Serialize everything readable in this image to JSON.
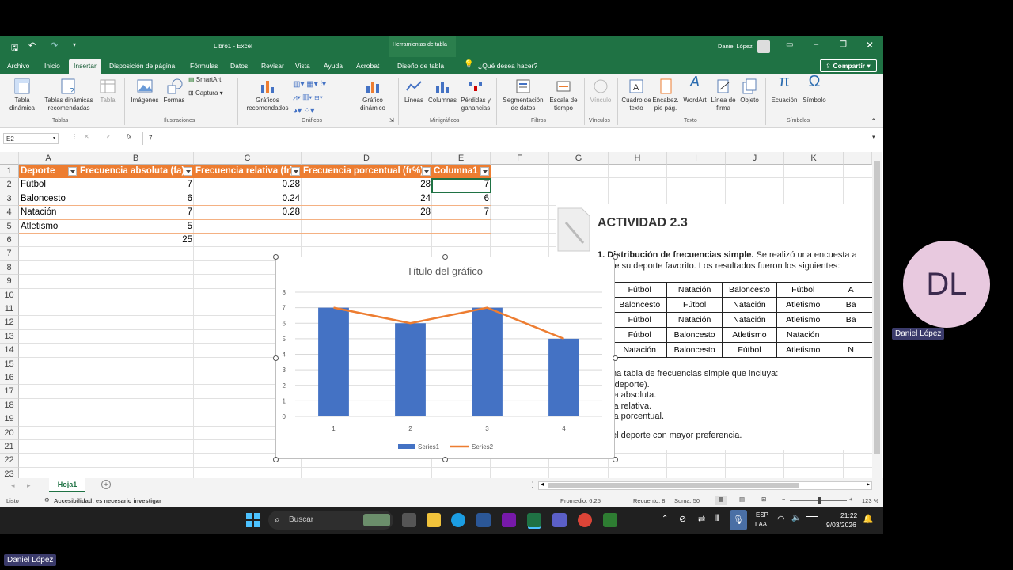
{
  "window": {
    "title": "Libro1 - Excel",
    "context_tab": "Herramientas de tabla",
    "user": "Daniel López"
  },
  "menu": [
    "Archivo",
    "Inicio",
    "Insertar",
    "Disposición de página",
    "Fórmulas",
    "Datos",
    "Revisar",
    "Vista",
    "Ayuda",
    "Acrobat",
    "Diseño de tabla"
  ],
  "menu_active": "Insertar",
  "tell_me": "¿Qué desea hacer?",
  "share": "Compartir",
  "ribbon": {
    "tabla_dinamica": "Tabla dinámica",
    "tablas_recomendadas": "Tablas dinámicas recomendadas",
    "tabla": "Tabla",
    "grupo_tablas": "Tablas",
    "imagenes": "Imágenes",
    "formas": "Formas",
    "smartart": "SmartArt",
    "captura": "Captura",
    "grupo_ilustraciones": "Ilustraciones",
    "graficos_recomendados": "Gráficos recomendados",
    "grafico_dinamico": "Gráfico dinámico",
    "grupo_graficos": "Gráficos",
    "lineas": "Líneas",
    "columnas": "Columnas",
    "perdidas": "Pérdidas y ganancias",
    "grupo_minigraficos": "Minigráficos",
    "segmentacion": "Segmentación de datos",
    "escala": "Escala de tiempo",
    "grupo_filtros": "Filtros",
    "vinculo": "Vínculo",
    "grupo_vinculos": "Vínculos",
    "cuadro_texto": "Cuadro de texto",
    "encabezado": "Encabez. pie pág.",
    "wordart": "WordArt",
    "linea_firma": "Línea de firma",
    "objeto": "Objeto",
    "grupo_texto": "Texto",
    "ecuacion": "Ecuación",
    "simbolo": "Símbolo",
    "grupo_simbolos": "Símbolos"
  },
  "formula": {
    "name_box": "E2",
    "fx": "fx",
    "value": "7"
  },
  "columns": [
    "A",
    "B",
    "C",
    "D",
    "E",
    "F",
    "G",
    "H",
    "I",
    "J",
    "K"
  ],
  "rows": [
    "1",
    "2",
    "3",
    "4",
    "5",
    "6",
    "7",
    "8",
    "9",
    "10",
    "11",
    "12",
    "13",
    "14",
    "15",
    "16",
    "17",
    "18",
    "19",
    "20",
    "21",
    "22",
    "23"
  ],
  "table": {
    "headers": [
      "Deporte",
      "Frecuencia absoluta (fa)",
      "Frecuencia relativa (fr)",
      "Frecuencia porcentual (fr%)",
      "Columna1"
    ],
    "rows": [
      [
        "Fútbol",
        "7",
        "0.28",
        "28",
        "7"
      ],
      [
        "Baloncesto",
        "6",
        "0.24",
        "24",
        "6"
      ],
      [
        "Natación",
        "7",
        "0.28",
        "28",
        "7"
      ],
      [
        "Atletismo",
        "5",
        "",
        "",
        ""
      ]
    ],
    "total": "25"
  },
  "activity": {
    "title": "ACTIVIDAD 2.3",
    "line1_bold": "1. Distribución de frecuencias simple.",
    "line1_rest": " Se realizó una encuesta a",
    "line2": "sobre su deporte favorito. Los resultados fueron los siguientes:",
    "survey": [
      [
        "Fútbol",
        "Natación",
        "Baloncesto",
        "Fútbol",
        "A"
      ],
      [
        "Baloncesto",
        "Fútbol",
        "Natación",
        "Atletismo",
        "Ba"
      ],
      [
        "Fútbol",
        "Natación",
        "Natación",
        "Atletismo",
        "Ba"
      ],
      [
        "Fútbol",
        "Baloncesto",
        "Atletismo",
        "Natación",
        ""
      ],
      [
        "Natación",
        "Baloncesto",
        "Fútbol",
        "Atletismo",
        "N"
      ]
    ],
    "instructions": [
      "na tabla de frecuencias simple que incluya:",
      "(deporte).",
      "ia absoluta.",
      "ia relativa.",
      "ia porcentual."
    ],
    "last": "el deporte con mayor preferencia."
  },
  "chart_data": {
    "type": "bar",
    "title": "Título del gráfico",
    "categories": [
      "1",
      "2",
      "3",
      "4"
    ],
    "ylim": [
      0,
      8
    ],
    "yticks": [
      "0",
      "1",
      "2",
      "3",
      "4",
      "5",
      "6",
      "7",
      "8"
    ],
    "series": [
      {
        "name": "Series1",
        "type": "bar",
        "values": [
          7,
          6,
          7,
          5
        ],
        "color": "#4472c4"
      },
      {
        "name": "Series2",
        "type": "line",
        "values": [
          7,
          6,
          7,
          5
        ],
        "color": "#ed7d31"
      }
    ],
    "legend": "bottom",
    "grid": true
  },
  "sheet_tab": "Hoja1",
  "status": {
    "ready": "Listo",
    "accessibility": "Accesibilidad: es necesario investigar",
    "promedio": "Promedio: 6.25",
    "recuento": "Recuento: 8",
    "suma": "Suma: 50",
    "zoom": "123 %"
  },
  "taskbar": {
    "search": "Buscar",
    "lang1": "ESP",
    "lang2": "LAA",
    "time": "21:22",
    "date": "9/03/2026"
  },
  "participant": {
    "initials": "DL",
    "name": "Daniel López"
  },
  "self_name": "Daniel López"
}
